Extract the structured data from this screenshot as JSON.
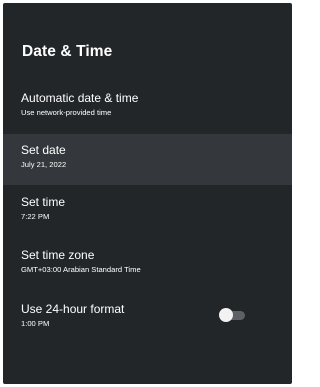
{
  "screen": {
    "title": "Date & Time",
    "background_color": "#232629",
    "selected_row_color": "#34373b"
  },
  "settings": [
    {
      "label": "Automatic date & time",
      "value": "Use network-provided time",
      "selected": false
    },
    {
      "label": "Set date",
      "value": "July 21, 2022",
      "selected": true
    },
    {
      "label": "Set time",
      "value": "7:22 PM",
      "selected": false
    },
    {
      "label": "Set time zone",
      "value": "GMT+03:00 Arabian Standard Time",
      "selected": false
    },
    {
      "label": "Use 24-hour format",
      "value": "1:00 PM",
      "selected": false,
      "toggle_on": false
    }
  ]
}
